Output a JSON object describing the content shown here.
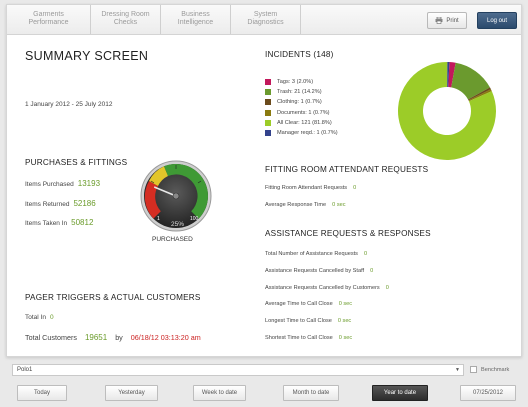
{
  "nav": {
    "tabs": [
      {
        "line1": "Garments",
        "line2": "Performance"
      },
      {
        "line1": "Dressing Room",
        "line2": "Checks"
      },
      {
        "line1": "Business",
        "line2": "Intelligence"
      },
      {
        "line1": "System",
        "line2": "Diagnostics"
      }
    ],
    "print_label": "Print",
    "logout_label": "Log out"
  },
  "summary": {
    "title": "SUMMARY SCREEN",
    "date_range": "1 January 2012 - 25 July 2012"
  },
  "purchases": {
    "heading": "PURCHASES & FITTINGS",
    "items_purchased_label": "Items Purchased",
    "items_purchased_value": "13193",
    "items_returned_label": "Items Returned",
    "items_returned_value": "52186",
    "items_taken_in_label": "Items Taken In",
    "items_taken_in_value": "50812",
    "gauge": {
      "min_label": "1",
      "max_label": "100",
      "percent_label": "25%",
      "percent": 25,
      "caption": "PURCHASED"
    }
  },
  "pager": {
    "heading": "PAGER TRIGGERS & ACTUAL CUSTOMERS",
    "total_in_label": "Total In",
    "total_in_value": "0",
    "total_customers_label": "Total Customers",
    "total_customers_value": "19651",
    "by_label": "by",
    "timestamp": "06/18/12 03:13:20 am"
  },
  "incidents": {
    "heading": "INCIDENTS (148)",
    "items": [
      {
        "label": "Tags: 3 (2.0%)",
        "color": "#c2185b",
        "value": 3
      },
      {
        "label": "Trash: 21 (14.2%)",
        "color": "#6b9a2e",
        "value": 21
      },
      {
        "label": "Clothing: 1 (0.7%)",
        "color": "#6b4b1c",
        "value": 1
      },
      {
        "label": "Documents: 1 (0.7%)",
        "color": "#8a7a10",
        "value": 1
      },
      {
        "label": "All Clear: 121 (81.8%)",
        "color": "#9ccc28",
        "value": 121
      },
      {
        "label": "Manager reqd.: 1 (0.7%)",
        "color": "#33428c",
        "value": 1
      }
    ]
  },
  "fitting_room": {
    "heading": "FITTING ROOM ATTENDANT REQUESTS",
    "requests_label": "Fitting Room Attendant Requests",
    "requests_value": "0",
    "avg_response_label": "Average Response Time",
    "avg_response_value": "0 sec"
  },
  "assistance": {
    "heading": "ASSISTANCE REQUESTS & RESPONSES",
    "rows": [
      {
        "label": "Total Number of Assistance Requests",
        "value": "0"
      },
      {
        "label": "Assistance Requests Cancelled by Staff",
        "value": "0"
      },
      {
        "label": "Assistance Requests Cancelled by Customers",
        "value": "0"
      },
      {
        "label": "Average Time to Call Close",
        "value": "0 sec"
      },
      {
        "label": "Longest Time to Call Close",
        "value": "0 sec"
      },
      {
        "label": "Shortest Time to Call Close",
        "value": "0 sec"
      }
    ]
  },
  "footer": {
    "store_select": "Polo1",
    "benchmark_label": "Benchmark",
    "buttons": [
      "Today",
      "Yesterday",
      "Week to date",
      "Month to date",
      "Year to date"
    ],
    "date_value": "07/25/2012"
  },
  "colors": {
    "accent_green": "#6a9b2a",
    "timestamp_red": "#cc2222",
    "logout_blue": "#2b4a6d"
  }
}
